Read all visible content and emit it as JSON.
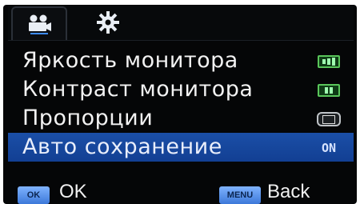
{
  "tabs": [
    {
      "name": "video-tab",
      "icon": "camera-icon",
      "active": true
    },
    {
      "name": "settings-tab",
      "icon": "gear-icon",
      "active": false
    }
  ],
  "menu": {
    "items": [
      {
        "label": "Яркость монитора",
        "value": "",
        "value_icon": "brightness-level-icon"
      },
      {
        "label": "Контраст монитора",
        "value": "",
        "value_icon": "contrast-level-icon"
      },
      {
        "label": "Пропорции",
        "value": "",
        "value_icon": "aspect-ratio-icon"
      },
      {
        "label": "Авто сохранение",
        "value": "ON",
        "value_icon": "",
        "selected": true
      }
    ]
  },
  "footer": {
    "ok_key": "OK",
    "ok_label": "OK",
    "menu_key": "MENU",
    "back_label": "Back"
  },
  "colors": {
    "background": "#050607",
    "selected_row": "#1b4fa7",
    "key": "#5b95f0",
    "text": "#f2f2f2",
    "green_indicator": "#59c65a"
  }
}
